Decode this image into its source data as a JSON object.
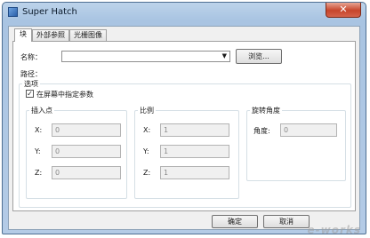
{
  "window": {
    "title": "Super Hatch",
    "close_glyph": "✕"
  },
  "tabs": [
    {
      "label": "块"
    },
    {
      "label": "外部参照"
    },
    {
      "label": "光栅图像"
    }
  ],
  "name_field": {
    "label": "名称：",
    "value": "",
    "arrow": "▼"
  },
  "browse_button": {
    "label": "浏览..."
  },
  "path": {
    "label": "路径："
  },
  "options": {
    "title": "选项",
    "checkbox_label": "在屏幕中指定参数",
    "checked": true,
    "check_glyph": "✓"
  },
  "insertion_point": {
    "title": "插入点",
    "x_label": "X:",
    "x_value": "0",
    "y_label": "Y:",
    "y_value": "0",
    "z_label": "Z:",
    "z_value": "0"
  },
  "scale": {
    "title": "比例",
    "x_label": "X:",
    "x_value": "1",
    "y_label": "Y:",
    "y_value": "1",
    "z_label": "Z:",
    "z_value": "1"
  },
  "rotation": {
    "title": "旋转角度",
    "angle_label": "角度:",
    "angle_value": "0"
  },
  "footer": {
    "ok_label": "确定",
    "cancel_label": "取消"
  },
  "watermark": "e-works"
}
